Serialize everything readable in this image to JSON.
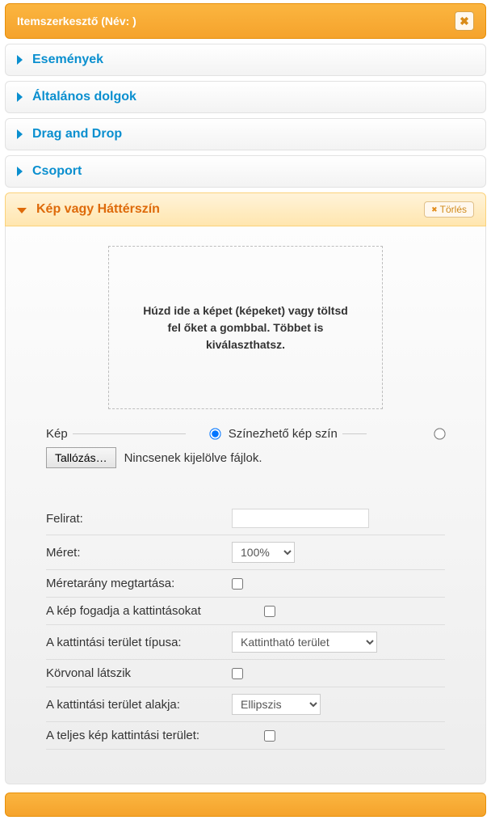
{
  "header": {
    "title": "Itemszerkesztő (Név:  )"
  },
  "accordion": [
    {
      "label": "Események"
    },
    {
      "label": "Általános dolgok"
    },
    {
      "label": "Drag and Drop"
    },
    {
      "label": "Csoport"
    },
    {
      "label": "Kép vagy Háttérszín",
      "delete_label": "Törlés"
    }
  ],
  "dropzone": {
    "text": "Húzd ide a képet (képeket) vagy töltsd fel őket a gombbal. Többet is kiválaszthatsz."
  },
  "imagerow": {
    "kep_label": "Kép",
    "colorable_label": "Színezhető kép szín",
    "browse_label": "Tallózás…",
    "nofiles_text": "Nincsenek kijelölve fájlok."
  },
  "form": {
    "felirat_label": "Felirat:",
    "felirat_value": "",
    "meret_label": "Méret:",
    "meret_value": "100%",
    "aspect_label": "Méretarány megtartása:",
    "clicks_label": "A kép fogadja a kattintásokat",
    "clicktype_label": "A kattintási terület típusa:",
    "clicktype_value": "Kattintható terület",
    "outline_label": "Körvonal látszik",
    "shape_label": "A kattintási terület alakja:",
    "shape_value": "Ellipszis",
    "fullclick_label": "A teljes kép kattintási terület:"
  }
}
